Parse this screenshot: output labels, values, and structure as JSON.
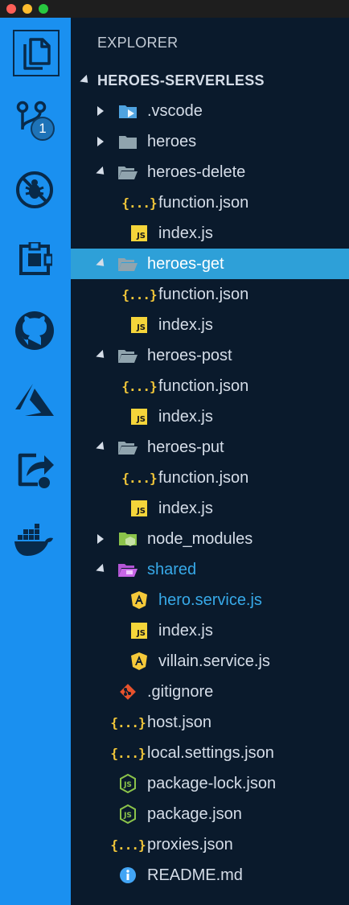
{
  "explorer_title": "EXPLORER",
  "root": {
    "label": "HEROES-SERVERLESS",
    "expanded": true
  },
  "badge_count": "1",
  "activity_bar": [
    {
      "name": "explorer",
      "icon": "files-icon"
    },
    {
      "name": "source-control",
      "icon": "source-control-icon"
    },
    {
      "name": "debug",
      "icon": "no-bug-icon"
    },
    {
      "name": "extensions",
      "icon": "extensions-icon"
    },
    {
      "name": "github",
      "icon": "github-icon"
    },
    {
      "name": "azure",
      "icon": "azure-icon"
    },
    {
      "name": "live-share",
      "icon": "live-share-icon"
    },
    {
      "name": "docker",
      "icon": "docker-icon"
    }
  ],
  "tree": [
    {
      "label": ".vscode",
      "type": "folder-vscode",
      "depth": 1,
      "twisty": "closed"
    },
    {
      "label": "heroes",
      "type": "folder",
      "depth": 1,
      "twisty": "closed"
    },
    {
      "label": "heroes-delete",
      "type": "folder-open",
      "depth": 1,
      "twisty": "open"
    },
    {
      "label": "function.json",
      "type": "json",
      "depth": 2
    },
    {
      "label": "index.js",
      "type": "js",
      "depth": 2
    },
    {
      "label": "heroes-get",
      "type": "folder-open",
      "depth": 1,
      "twisty": "open",
      "selected": true
    },
    {
      "label": "function.json",
      "type": "json",
      "depth": 2
    },
    {
      "label": "index.js",
      "type": "js",
      "depth": 2
    },
    {
      "label": "heroes-post",
      "type": "folder-open",
      "depth": 1,
      "twisty": "open"
    },
    {
      "label": "function.json",
      "type": "json",
      "depth": 2
    },
    {
      "label": "index.js",
      "type": "js",
      "depth": 2
    },
    {
      "label": "heroes-put",
      "type": "folder-open",
      "depth": 1,
      "twisty": "open"
    },
    {
      "label": "function.json",
      "type": "json",
      "depth": 2
    },
    {
      "label": "index.js",
      "type": "js",
      "depth": 2
    },
    {
      "label": "node_modules",
      "type": "folder-node",
      "depth": 1,
      "twisty": "closed"
    },
    {
      "label": "shared",
      "type": "folder-shared",
      "depth": 1,
      "twisty": "open",
      "highlight": true
    },
    {
      "label": "hero.service.js",
      "type": "angular",
      "depth": 2,
      "highlight": true
    },
    {
      "label": "index.js",
      "type": "js",
      "depth": 2
    },
    {
      "label": "villain.service.js",
      "type": "angular",
      "depth": 2
    },
    {
      "label": ".gitignore",
      "type": "git",
      "depth": 1
    },
    {
      "label": "host.json",
      "type": "json",
      "depth": 1
    },
    {
      "label": "local.settings.json",
      "type": "json",
      "depth": 1
    },
    {
      "label": "package-lock.json",
      "type": "nodejs",
      "depth": 1
    },
    {
      "label": "package.json",
      "type": "nodejs",
      "depth": 1
    },
    {
      "label": "proxies.json",
      "type": "json",
      "depth": 1
    },
    {
      "label": "README.md",
      "type": "info",
      "depth": 1
    }
  ],
  "colors": {
    "activity_bar": "#1a90f0",
    "sidebar_bg": "#0a1a2c",
    "selection": "#2ea0d8",
    "highlight_text": "#37a9e8",
    "json_icon": "#f5c93a",
    "js_icon": "#f5d53a"
  }
}
